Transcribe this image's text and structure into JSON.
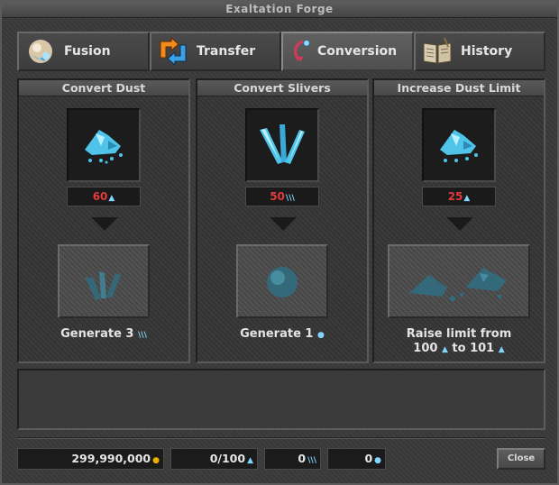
{
  "window": {
    "title": "Exaltation Forge"
  },
  "tabs": [
    {
      "label": "Fusion",
      "icon": "fusion-icon",
      "active": false
    },
    {
      "label": "Transfer",
      "icon": "transfer-arrows-icon",
      "active": false
    },
    {
      "label": "Conversion",
      "icon": "conversion-icon",
      "active": true
    },
    {
      "label": "History",
      "icon": "history-book-icon",
      "active": false
    }
  ],
  "panels": [
    {
      "title": "Convert Dust",
      "cost": "60",
      "cost_unit": "▲",
      "result_line1": "Generate 3",
      "result_unit": "\\\\\\"
    },
    {
      "title": "Convert Slivers",
      "cost": "50",
      "cost_unit": "\\\\\\",
      "result_line1": "Generate 1",
      "result_unit": "●"
    },
    {
      "title": "Increase Dust Limit",
      "cost": "25",
      "cost_unit": "▲",
      "result_line1": "Raise limit from",
      "result_line2_a": "100",
      "result_line2_b": "to 101",
      "result_unit": "▲"
    }
  ],
  "balances": {
    "gold": "299,990,000",
    "dust": "0/100",
    "slivers": "0",
    "cores": "0"
  },
  "buttons": {
    "close": "Close"
  },
  "colors": {
    "cost_red": "#e23b3b",
    "crystal_blue": "#7fd6ff",
    "gold": "#f0b000"
  }
}
